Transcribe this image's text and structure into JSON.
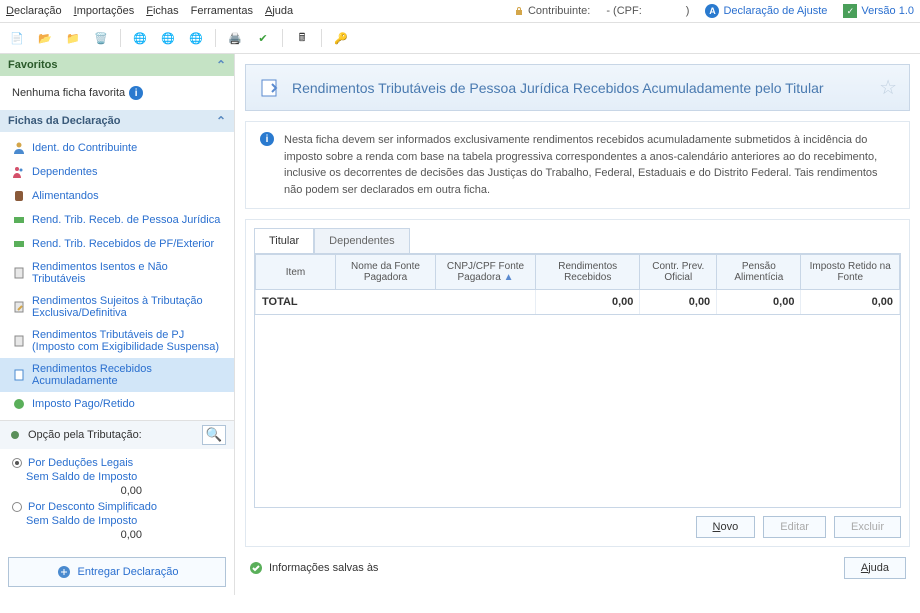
{
  "menu": {
    "declaracao": "Declaração",
    "importacoes": "Importações",
    "fichas": "Fichas",
    "ferramentas": "Ferramentas",
    "ajuda": "Ajuda"
  },
  "header": {
    "contribuinte_label": "Contribuinte:",
    "cpf_label": "- (CPF:",
    "cpf_close": ")",
    "decl_ajuste": "Declaração de Ajuste",
    "versao": "Versão 1.0"
  },
  "sidebar": {
    "favoritos": "Favoritos",
    "fav_empty": "Nenhuma ficha favorita",
    "fichas_header": "Fichas da Declaração",
    "items": [
      "Ident. do Contribuinte",
      "Dependentes",
      "Alimentandos",
      "Rend. Trib. Receb. de Pessoa Jurídica",
      "Rend. Trib. Recebidos de PF/Exterior",
      "Rendimentos Isentos e Não Tributáveis",
      "Rendimentos Sujeitos à Tributação Exclusiva/Definitiva",
      "Rendimentos Tributáveis de PJ (Imposto com Exigibilidade Suspensa)",
      "Rendimentos Recebidos Acumuladamente",
      "Imposto Pago/Retido"
    ],
    "trib_header": "Opção pela Tributação:",
    "opt_deducoes": "Por Deduções Legais",
    "sem_saldo": "Sem Saldo de Imposto",
    "val1": "0,00",
    "opt_simplif": "Por Desconto Simplificado",
    "val2": "0,00",
    "entregar": "Entregar Declaração"
  },
  "main": {
    "title": "Rendimentos Tributáveis de Pessoa Jurídica Recebidos Acumuladamente pelo Titular",
    "info_text": "Nesta ficha devem ser informados exclusivamente rendimentos recebidos acumuladamente submetidos à incidência do imposto sobre a renda com base na tabela progressiva correspondentes a anos-calendário anteriores ao do recebimento, inclusive os decorrentes de decisões das Justiças do Trabalho, Federal, Estaduais e do Distrito Federal. Tais rendimentos não podem ser declarados em outra ficha.",
    "tab_titular": "Titular",
    "tab_dependentes": "Dependentes"
  },
  "grid": {
    "headers": {
      "item": "Item",
      "nome_fonte": "Nome da Fonte Pagadora",
      "cnpj": "CNPJ/CPF Fonte Pagadora",
      "rend": "Rendimentos Recebidos",
      "contr": "Contr. Prev. Oficial",
      "pensao": "Pensão Alimentícia",
      "imposto": "Imposto Retido na Fonte"
    },
    "total_label": "TOTAL",
    "zero": "0,00"
  },
  "buttons": {
    "novo": "Novo",
    "editar": "Editar",
    "excluir": "Excluir",
    "ajuda": "Ajuda"
  },
  "status": "Informações salvas às"
}
